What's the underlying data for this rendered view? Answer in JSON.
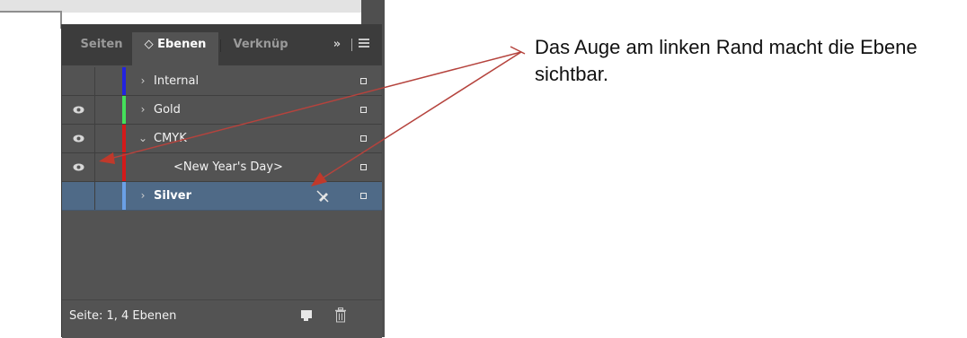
{
  "panel": {
    "tabs": [
      {
        "label": "Seiten",
        "active": false
      },
      {
        "label": "◇ Ebenen",
        "active": true
      },
      {
        "label": "Verknüp",
        "active": false
      }
    ],
    "overflow_label": "»",
    "layers": [
      {
        "name": "Internal",
        "color": "#2323e0",
        "visible": false,
        "disclosure": "›",
        "selected": false,
        "sublayer": false
      },
      {
        "name": "Gold",
        "color": "#44e05a",
        "visible": true,
        "disclosure": "›",
        "selected": false,
        "sublayer": false
      },
      {
        "name": "CMYK",
        "color": "#d41a1a",
        "visible": true,
        "disclosure": "⌄",
        "selected": false,
        "sublayer": false
      },
      {
        "name": "<New Year's Day>",
        "color": "#d41a1a",
        "visible": true,
        "disclosure": "",
        "selected": false,
        "sublayer": true
      },
      {
        "name": "Silver",
        "color": "#6aa0e6",
        "visible": false,
        "disclosure": "›",
        "selected": true,
        "sublayer": false,
        "locked_pen_icon": "pen-slash-icon"
      }
    ],
    "status": "Seite: 1, 4 Ebenen",
    "footer_icons": [
      "new-layer-icon",
      "trash-icon"
    ]
  },
  "annotation": {
    "text": "Das Auge am linken Rand macht die Ebene sichtbar.",
    "arrow_color": "#c0392b"
  }
}
